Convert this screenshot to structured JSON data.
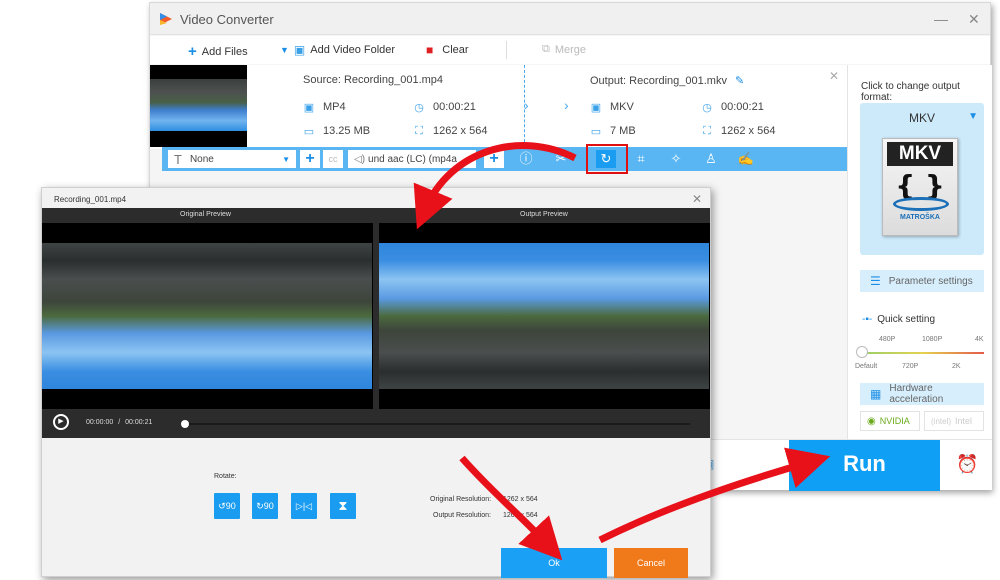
{
  "app": {
    "title": "Video Converter",
    "minimize_icon": "minimize-icon",
    "close_icon": "close-icon"
  },
  "toolbar": {
    "add_files": "Add Files",
    "add_video_folder": "Add Video Folder",
    "clear": "Clear",
    "merge": "Merge"
  },
  "file": {
    "source_title": "Source: Recording_001.mp4",
    "output_title": "Output: Recording_001.mkv",
    "source": {
      "format": "MP4",
      "duration": "00:00:21",
      "size": "13.25 MB",
      "resolution": "1262 x 564"
    },
    "output": {
      "format": "MKV",
      "duration": "00:00:21",
      "size": "7 MB",
      "resolution": "1262 x 564"
    }
  },
  "edit_bar": {
    "subtitle_value": "None",
    "audio_value": "und aac (LC) (mp4a",
    "tools": [
      "info",
      "cut",
      "rotate",
      "crop",
      "effects",
      "watermark",
      "edit"
    ]
  },
  "right_panel": {
    "hint": "Click to change output format:",
    "format": "MKV",
    "format_icon_label": "MKV",
    "format_icon_brand": "MATROŠKA",
    "parameter_settings": "Parameter settings",
    "quick_setting": "Quick setting",
    "quality_ticks_top": [
      "480P",
      "1080P",
      "4K"
    ],
    "quality_ticks_bottom": [
      "Default",
      "720P",
      "2K"
    ],
    "quality_selected": "Default",
    "hardware_acceleration": "Hardware acceleration",
    "nvidia": "NVIDIA",
    "intel": "Intel"
  },
  "bottom": {
    "run": "Run"
  },
  "dialog": {
    "title": "Recording_001.mp4",
    "original_preview": "Original Preview",
    "output_preview": "Output Preview",
    "current_time": "00:00:00",
    "total_time": "00:00:21",
    "time_separator": "/",
    "playback_progress": 0,
    "rotate_label": "Rotate:",
    "rotate_buttons": [
      {
        "name": "rotate-left-90",
        "label": "90"
      },
      {
        "name": "rotate-right-90",
        "label": "90"
      },
      {
        "name": "flip-horizontal",
        "label": "▷|◁"
      },
      {
        "name": "flip-vertical",
        "label": "⧗"
      }
    ],
    "original_resolution_label": "Original Resolution:",
    "original_resolution": "1262 x 564",
    "output_resolution_label": "Output Resolution:",
    "output_resolution": "1262 x 564",
    "ok": "Ok",
    "cancel": "Cancel"
  },
  "colors": {
    "accent": "#0fa0f5",
    "edit_bar": "#5ab6f2",
    "cancel": "#f07a1a",
    "highlight": "#e01010",
    "annotation_arrow": "#e8111a"
  }
}
